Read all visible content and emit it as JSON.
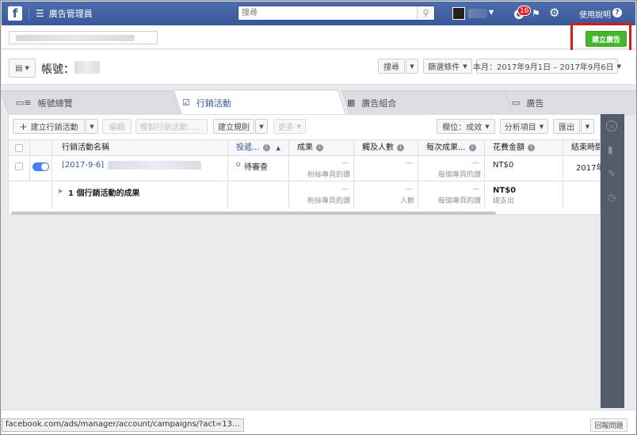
{
  "topbar": {
    "logo": "f",
    "app_title": "廣告管理員",
    "search_placeholder": "搜尋",
    "notif_count": "16",
    "help_label": "使用說明",
    "help_icon": "?"
  },
  "header": {
    "create_ad_label": "建立廣告"
  },
  "account": {
    "label": "帳號："
  },
  "filters": {
    "search_label": "搜尋",
    "filter_label": "篩選條件",
    "date_range": "本月：2017年9月1日 – 2017年9月6日"
  },
  "tabs": [
    {
      "label": "帳號總覽"
    },
    {
      "label": "行銷活動"
    },
    {
      "label": "廣告組合"
    },
    {
      "label": "廣告"
    }
  ],
  "toolbar": {
    "create_campaign": "建立行銷活動",
    "edit": "編輯",
    "duplicate": "複製行銷活動……",
    "create_rule": "建立規則",
    "more": "更多",
    "columns": "欄位：成效",
    "breakdown": "分析項目",
    "export": "匯出"
  },
  "table": {
    "headers": {
      "name": "行銷活動名稱",
      "delivery": "投遞...",
      "results": "成果",
      "reach": "觸及人數",
      "cost_per_result": "每次成果...",
      "amount_spent": "花費金額",
      "end_time": "結束時間"
    },
    "row1": {
      "name": "[2017-9-6]",
      "delivery": "待審查",
      "results": "—",
      "results_sub": "粉絲專頁的讚",
      "reach": "—",
      "cost": "—",
      "cost_sub": "每個專頁的讚",
      "spent": "NT$0",
      "end": "2017年"
    },
    "summary": {
      "label": "1 個行銷活動的成果",
      "results": "—",
      "results_sub": "粉絲專頁的讚",
      "reach": "—",
      "reach_sub": "人數",
      "cost": "—",
      "cost_sub": "每個專頁的讚",
      "spent": "NT$0",
      "spent_sub": "總支出"
    }
  },
  "footer": {
    "status_url": "facebook.com/ads/manager/account/campaigns/?act=13...",
    "report_label": "回報問題"
  }
}
